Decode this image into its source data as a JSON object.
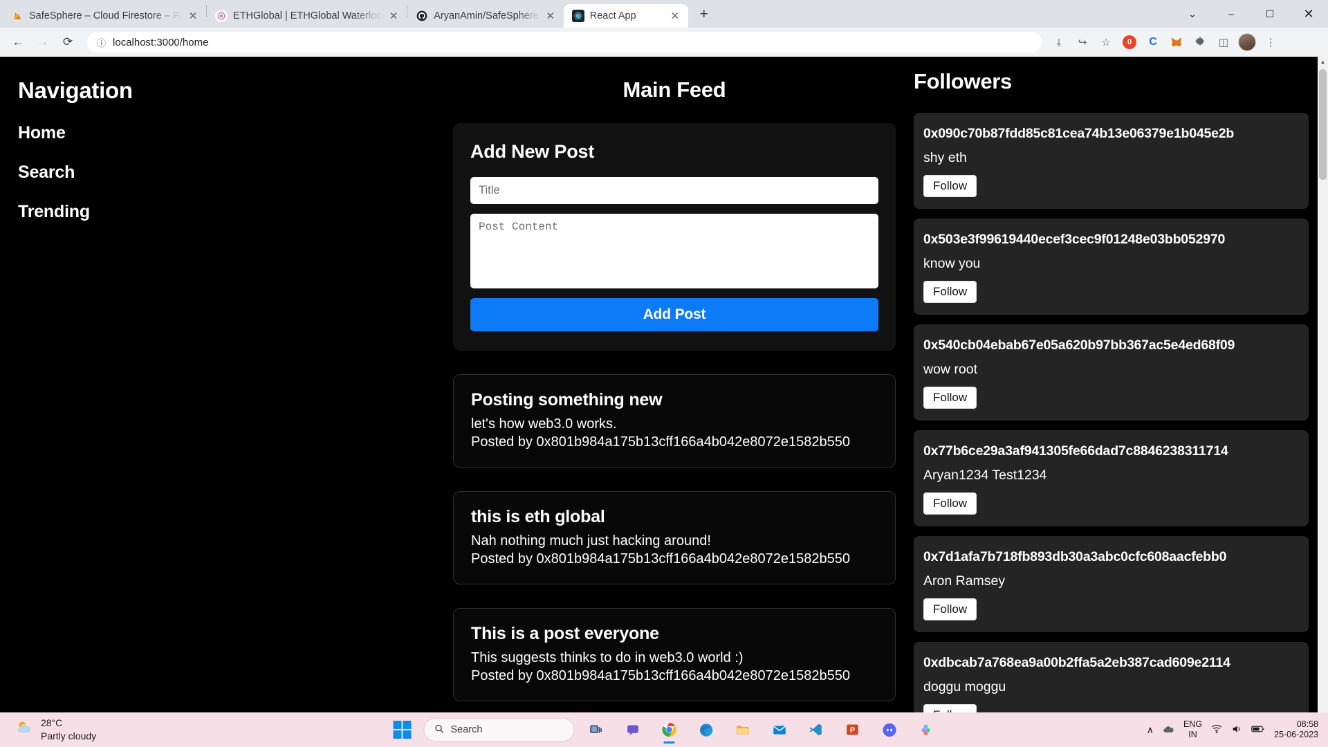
{
  "browser": {
    "tabs": [
      {
        "title": "SafeSphere – Cloud Firestore – Fi",
        "favicon": "firebase-icon",
        "glyph": "▲",
        "active": false
      },
      {
        "title": "ETHGlobal | ETHGlobal Waterloo",
        "favicon": "ethglobal-icon",
        "glyph": "◉",
        "active": false
      },
      {
        "title": "AryanAmin/SafeSphere",
        "favicon": "github-icon",
        "glyph": "●",
        "active": false
      },
      {
        "title": "React App",
        "favicon": "react-icon",
        "glyph": "⚛",
        "active": true
      }
    ],
    "new_tab_label": "+",
    "close_label": "✕",
    "window_controls": {
      "minimize": "–",
      "maximize": "☐",
      "close": "✕",
      "tab_search": "⌄"
    },
    "nav": {
      "back": "←",
      "forward": "→",
      "reload": "⟳"
    },
    "url": "localhost:3000/home",
    "url_icon_glyph": "ⓘ",
    "toolbar_icons": [
      {
        "name": "download-icon",
        "glyph": "⤓"
      },
      {
        "name": "share-icon",
        "glyph": "↪"
      },
      {
        "name": "bookmark-star-icon",
        "glyph": "☆"
      },
      {
        "name": "adblock-extension-icon",
        "glyph": "0"
      },
      {
        "name": "colorzilla-extension-icon",
        "glyph": "C"
      },
      {
        "name": "metamask-extension-icon",
        "glyph": "ᾘA"
      },
      {
        "name": "extensions-puzzle-icon",
        "glyph": "❖"
      },
      {
        "name": "side-panel-icon",
        "glyph": "◫"
      }
    ],
    "menu_glyph": "⋮"
  },
  "scrollbar": {
    "up_arrow": "▲",
    "down_arrow": "▼"
  },
  "sidebar": {
    "title": "Navigation",
    "items": [
      {
        "label": "Home"
      },
      {
        "label": "Search"
      },
      {
        "label": "Trending"
      }
    ]
  },
  "feed": {
    "title": "Main Feed",
    "compose": {
      "heading": "Add New Post",
      "title_value": "",
      "title_placeholder": "Title",
      "content_value": "",
      "content_placeholder": "Post Content",
      "submit_label": "Add Post"
    },
    "posted_by_prefix": "Posted by ",
    "posts": [
      {
        "title": "Posting something new",
        "body": "let's how web3.0 works.",
        "author": "0x801b984a175b13cff166a4b042e8072e1582b550"
      },
      {
        "title": "this is eth global",
        "body": "Nah nothing much just hacking around!",
        "author": "0x801b984a175b13cff166a4b042e8072e1582b550"
      },
      {
        "title": "This is a post everyone",
        "body": "This suggests thinks to do in web3.0 world :)",
        "author": "0x801b984a175b13cff166a4b042e8072e1582b550"
      }
    ]
  },
  "followers": {
    "title": "Followers",
    "follow_label": "Follow",
    "items": [
      {
        "address": "0x090c70b87fdd85c81cea74b13e06379e1b045e2b",
        "name": "shy eth"
      },
      {
        "address": "0x503e3f99619440ecef3cec9f01248e03bb052970",
        "name": "know you"
      },
      {
        "address": "0x540cb04ebab67e05a620b97bb367ac5e4ed68f09",
        "name": "wow root"
      },
      {
        "address": "0x77b6ce29a3af941305fe66dad7c8846238311714",
        "name": "Aryan1234 Test1234"
      },
      {
        "address": "0x7d1afa7b718fb893db30a3abc0cfc608aacfebb0",
        "name": "Aron Ramsey"
      },
      {
        "address": "0xdbcab7a768ea9a00b2ffa5a2eb387cad609e2114",
        "name": "doggu moggu"
      }
    ]
  },
  "taskbar": {
    "weather": {
      "temp": "28°C",
      "condition": "Partly cloudy",
      "icon_glyph": "⛅"
    },
    "search_placeholder": "Search",
    "search_icon_glyph": "⚲",
    "apps": [
      {
        "name": "task-view-icon",
        "glyph": "❐"
      },
      {
        "name": "teams-icon",
        "glyph": "὞A"
      },
      {
        "name": "chrome-icon",
        "glyph": "●"
      },
      {
        "name": "edge-icon",
        "glyph": "◑"
      },
      {
        "name": "file-explorer-icon",
        "glyph": "὜1"
      },
      {
        "name": "mail-icon",
        "glyph": "✉"
      },
      {
        "name": "vscode-icon",
        "glyph": "◈"
      },
      {
        "name": "powerpoint-icon",
        "glyph": "P"
      },
      {
        "name": "discord-icon",
        "glyph": "◔"
      },
      {
        "name": "figma-icon",
        "glyph": "✦"
      }
    ],
    "tray": {
      "chevron_glyph": "∧",
      "cloud_glyph": "☁",
      "wifi_glyph": "◡",
      "volume_glyph": "ὐA",
      "battery_glyph": "ὐB",
      "lang_line1": "ENG",
      "lang_line2": "IN",
      "time": "08:58",
      "date": "25-06-2023"
    }
  },
  "colors": {
    "accent_blue": "#0d7bf7",
    "page_bg": "#000000",
    "card_bg": "#111111",
    "follower_card_bg": "#242424",
    "taskbar_bg": "#f6dfe6"
  }
}
